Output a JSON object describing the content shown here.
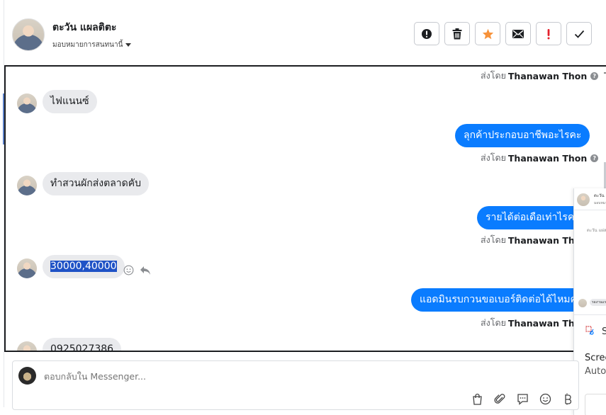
{
  "header": {
    "contact_name": "ตะวัน แผลติตะ",
    "assign_label": "มอบหมายการสนทนานี้",
    "actions": [
      {
        "name": "report-button",
        "icon": "alert-circle-icon"
      },
      {
        "name": "delete-button",
        "icon": "trash-icon"
      },
      {
        "name": "star-button",
        "icon": "star-icon",
        "color": "#f7923a"
      },
      {
        "name": "mark-unread-button",
        "icon": "envelope-icon"
      },
      {
        "name": "mark-important-button",
        "icon": "exclamation-icon",
        "color": "#e4212c"
      },
      {
        "name": "done-button",
        "icon": "checkmark-icon"
      }
    ]
  },
  "chat": {
    "sent_by_prefix": "ส่งโดย",
    "sent_by_name": "Thanawan Thon",
    "messages": [
      {
        "direction": "in",
        "text": "ไฟแนนซ์"
      },
      {
        "direction": "out",
        "text": "ลุกค้าประกอบอาชีพอะไรคะ"
      },
      {
        "direction": "in",
        "text": "ทำสวนผักส่งตลาดคับ"
      },
      {
        "direction": "out",
        "text": "รายได้ต่อเดือเท่าไรคะ"
      },
      {
        "direction": "in",
        "text": "30000,40000",
        "selected": true
      },
      {
        "direction": "out",
        "text": "แอดมินรบกวนขอเบอร์ติดต่อได้ไหมคะ"
      },
      {
        "direction": "in",
        "text": "0925027386"
      }
    ]
  },
  "preview": {
    "name": "ตะวัน แ",
    "sub": "มอบหมา",
    "msg": "ตะวัน แผ่ลติ",
    "bubble": "รองานแร",
    "snip_label": "S",
    "text1": "Scree",
    "text2": "Autor"
  },
  "composer": {
    "placeholder": "ตอบกลับใน Messenger..."
  },
  "colors": {
    "bubble_out": "#0a7cff",
    "bubble_in": "#e9eaed",
    "selection": "#1f52c6",
    "star": "#f7923a",
    "important": "#e4212c"
  }
}
